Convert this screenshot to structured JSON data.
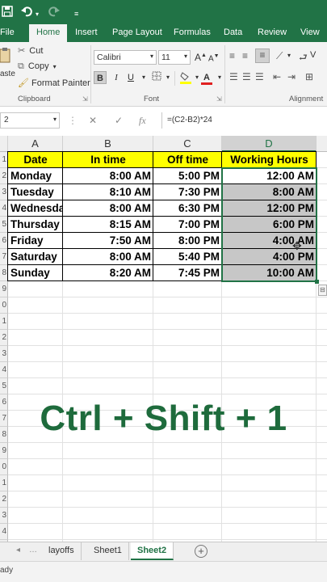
{
  "titlebar": {
    "save_icon": "save-icon",
    "undo_icon": "undo-icon",
    "redo_icon": "redo-icon",
    "customize_icon": "customize-toolbar-icon"
  },
  "tabs": [
    {
      "label": "File"
    },
    {
      "label": "Home",
      "active": true
    },
    {
      "label": "Insert"
    },
    {
      "label": "Page Layout"
    },
    {
      "label": "Formulas"
    },
    {
      "label": "Data"
    },
    {
      "label": "Review"
    },
    {
      "label": "View"
    }
  ],
  "ribbon": {
    "paste_label": "aste",
    "cut_label": "Cut",
    "copy_label": "Copy",
    "format_painter_label": "Format Painter",
    "clipboard_label": "Clipboard",
    "font_name": "Calibri",
    "font_size": "11",
    "bold": "B",
    "italic": "I",
    "underline": "U",
    "font_label": "Font",
    "alignment_label": "Alignment",
    "wrap_label": "V"
  },
  "formula_bar": {
    "name_box": "2",
    "fx_label": "fx",
    "formula": "=(C2-B2)*24"
  },
  "grid": {
    "columns": [
      "A",
      "B",
      "C",
      "D"
    ],
    "selected_column": "D",
    "row_numbers": [
      "1",
      "2",
      "3",
      "4",
      "5",
      "6",
      "7",
      "8",
      "9",
      "0",
      "1",
      "2",
      "3",
      "4",
      "5",
      "6",
      "7",
      "8",
      "9",
      "0",
      "1",
      "2",
      "3",
      "4",
      "5"
    ],
    "headers": [
      "Date",
      "In time",
      "Off time",
      "Working Hours"
    ],
    "rows": [
      {
        "day": "Monday",
        "in": "8:00 AM",
        "off": "5:00 PM",
        "hours": "12:00 AM"
      },
      {
        "day": "Tuesday",
        "in": "8:10 AM",
        "off": "7:30 PM",
        "hours": "8:00 AM"
      },
      {
        "day": "Wednesday",
        "in": "8:00 AM",
        "off": "6:30 PM",
        "hours": "12:00 PM"
      },
      {
        "day": "Thursday",
        "in": "8:15 AM",
        "off": "7:00 PM",
        "hours": "6:00 PM"
      },
      {
        "day": "Friday",
        "in": "7:50 AM",
        "off": "8:00 PM",
        "hours": "4:00 AM"
      },
      {
        "day": "Saturday",
        "in": "8:00 AM",
        "off": "5:40 PM",
        "hours": "4:00 PM"
      },
      {
        "day": "Sunday",
        "in": "8:20 AM",
        "off": "7:45 PM",
        "hours": "10:00 AM"
      }
    ]
  },
  "overlay_text": "Ctrl + Shift + 1",
  "sheets": [
    {
      "label": "layoffs"
    },
    {
      "label": "Sheet1"
    },
    {
      "label": "Sheet2",
      "active": true
    }
  ],
  "status": "ady",
  "colors": {
    "excel_green": "#217346",
    "header_yellow": "#ffff00",
    "selection_gray": "#c7c7c7",
    "overlay_green": "#1e6b3c"
  }
}
